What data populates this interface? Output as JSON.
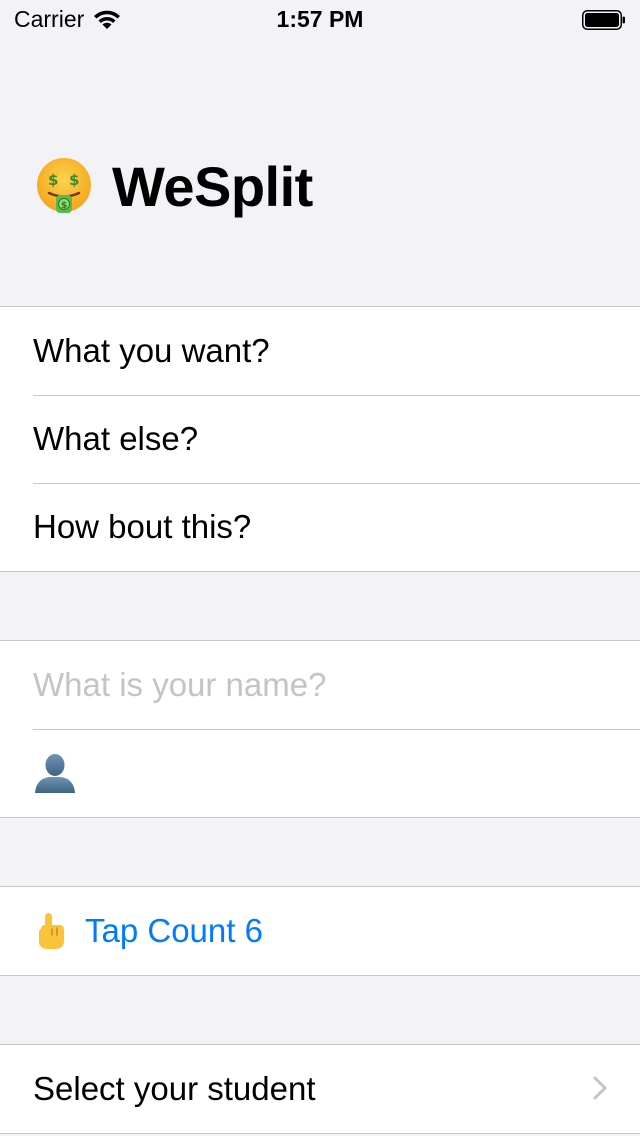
{
  "status_bar": {
    "carrier": "Carrier",
    "time": "1:57 PM",
    "wifi_icon": "wifi-icon",
    "battery_icon": "battery-full-icon"
  },
  "header": {
    "title": "WeSplit",
    "emoji_icon": "money-mouth-face-icon"
  },
  "section_one": {
    "items": [
      {
        "label": "What you want?"
      },
      {
        "label": "What else?"
      },
      {
        "label": "How bout this?"
      }
    ]
  },
  "section_two": {
    "name_field": {
      "value": "",
      "placeholder": "What is your name?"
    },
    "avatar_icon": "person-silhouette-icon"
  },
  "section_three": {
    "tap_icon": "pointing-up-hand-icon",
    "tap_label": "Tap Count 6"
  },
  "section_four": {
    "picker_label": "Select your student",
    "chevron_icon": "chevron-right-icon"
  },
  "colors": {
    "background": "#f2f2f7",
    "cell": "#ffffff",
    "separator": "#c8c7cc",
    "accent": "#007aff",
    "placeholder": "#c4c4c6"
  }
}
